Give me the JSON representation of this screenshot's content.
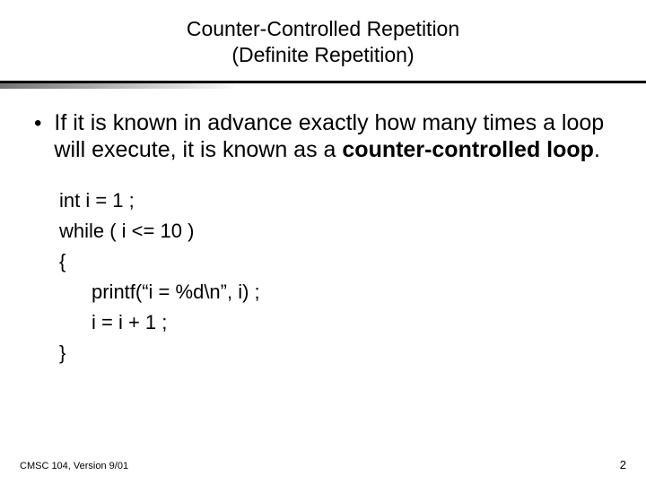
{
  "title": {
    "line1": "Counter-Controlled Repetition",
    "line2": "(Definite Repetition)"
  },
  "bullet": {
    "marker": "•",
    "text_prefix": "If it is known in advance exactly how many times a loop will execute, it is known as a ",
    "bold_term": "counter-controlled loop",
    "suffix": "."
  },
  "code": {
    "l1": "int i = 1 ;",
    "l2": "while ( i <= 10 )",
    "l3": "{",
    "l4": "printf(“i = %d\\n”, i) ;",
    "l5": "i = i + 1 ;",
    "l6": "}"
  },
  "footer": "CMSC 104, Version 9/01",
  "page_number": "2"
}
